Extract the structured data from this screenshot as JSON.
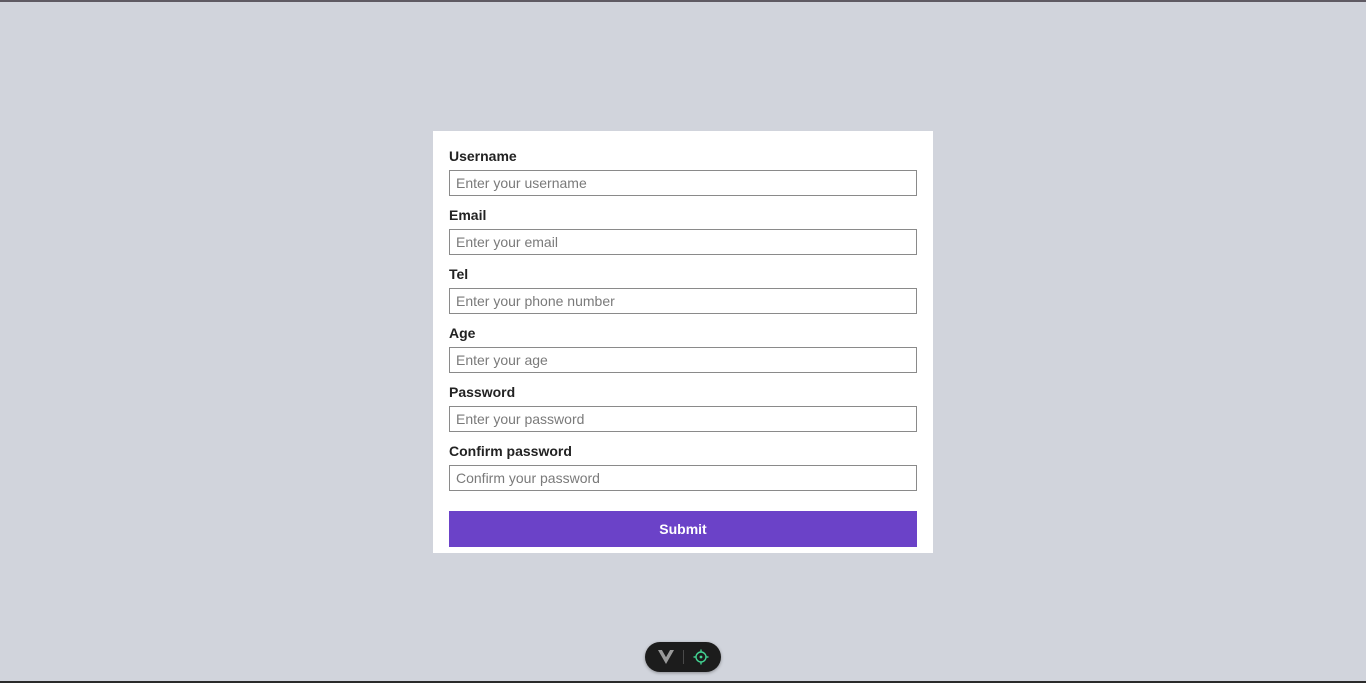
{
  "form": {
    "fields": [
      {
        "label": "Username",
        "placeholder": "Enter your username",
        "type": "text"
      },
      {
        "label": "Email",
        "placeholder": "Enter your email",
        "type": "email"
      },
      {
        "label": "Tel",
        "placeholder": "Enter your phone number",
        "type": "tel"
      },
      {
        "label": "Age",
        "placeholder": "Enter your age",
        "type": "number"
      },
      {
        "label": "Password",
        "placeholder": "Enter your password",
        "type": "password"
      },
      {
        "label": "Confirm password",
        "placeholder": "Confirm your password",
        "type": "password"
      }
    ],
    "submit_label": "Submit"
  },
  "devtools": {
    "vue_icon": "vue-logo-icon",
    "inspect_icon": "crosshair-icon",
    "inspect_color": "#42d392"
  },
  "colors": {
    "background": "#d1d4dc",
    "card": "#ffffff",
    "accent": "#6b42c8"
  }
}
